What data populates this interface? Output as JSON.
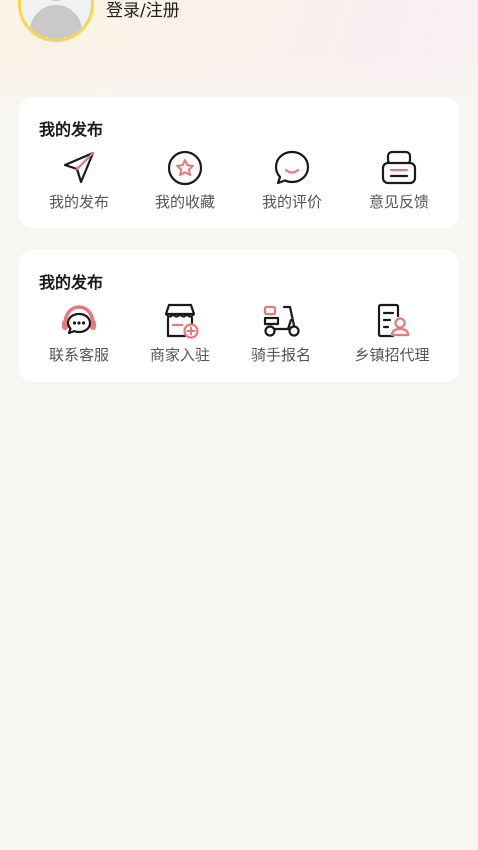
{
  "header": {
    "login_label": "登录/注册"
  },
  "colors": {
    "accent": "#e8787a",
    "icon_stroke": "#1a1a1a",
    "avatar_ring": "#f3d94a"
  },
  "sections": [
    {
      "title": "我的发布",
      "items": [
        {
          "label": "我的发布",
          "icon": "paper-plane-icon"
        },
        {
          "label": "我的收藏",
          "icon": "star-circle-icon"
        },
        {
          "label": "我的评价",
          "icon": "chat-bubble-icon"
        },
        {
          "label": "意见反馈",
          "icon": "feedback-printer-icon"
        }
      ]
    },
    {
      "title": "我的发布",
      "items": [
        {
          "label": "联系客服",
          "icon": "headset-icon"
        },
        {
          "label": "商家入驻",
          "icon": "store-add-icon"
        },
        {
          "label": "骑手报名",
          "icon": "scooter-icon"
        },
        {
          "label": "乡镇招代理",
          "icon": "agent-document-icon"
        }
      ]
    }
  ]
}
